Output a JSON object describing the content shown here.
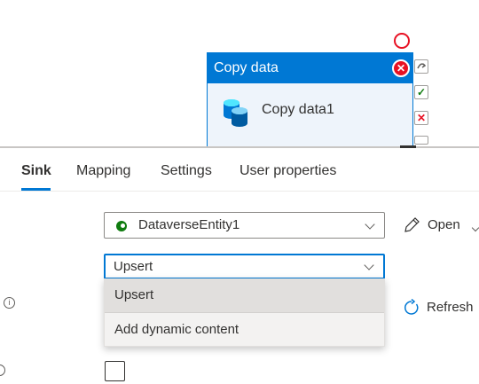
{
  "canvas": {
    "activity": {
      "type_title": "Copy data",
      "name": "Copy data1"
    },
    "ports": {
      "success": "✓",
      "failure": "✕"
    }
  },
  "tabs": [
    {
      "label": "Sink",
      "active": true
    },
    {
      "label": "Mapping",
      "active": false
    },
    {
      "label": "Settings",
      "active": false
    },
    {
      "label": "User properties",
      "active": false
    }
  ],
  "sink": {
    "dataset": {
      "value": "DataverseEntity1",
      "open_label": "Open"
    },
    "write_behavior": {
      "value": "Upsert",
      "options": [
        "Upsert",
        "Add dynamic content"
      ]
    },
    "refresh_label": "Refresh",
    "checkbox_checked": false
  },
  "colors": {
    "accent": "#0078d4",
    "error": "#e81123",
    "success": "#107c10"
  }
}
